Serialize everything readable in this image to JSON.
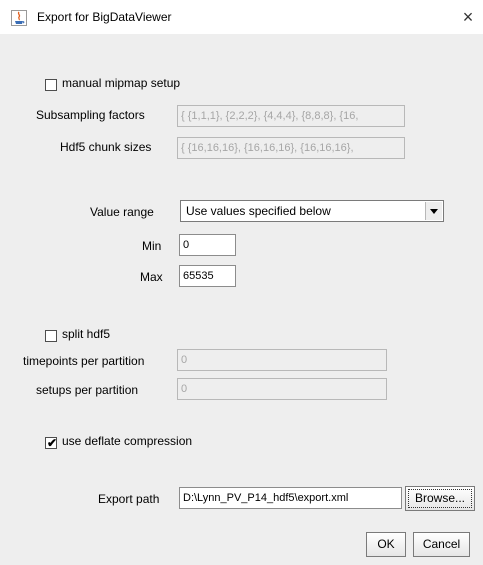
{
  "window": {
    "title": "Export for BigDataViewer",
    "close_symbol": "×"
  },
  "mipmap": {
    "checkbox_label": "manual mipmap setup",
    "checked": false,
    "subsampling_label": "Subsampling factors",
    "subsampling_value": "{ {1,1,1}, {2,2,2}, {4,4,4}, {8,8,8}, {16,",
    "chunk_label": "Hdf5 chunk sizes",
    "chunk_value": "{ {16,16,16}, {16,16,16}, {16,16,16},"
  },
  "range": {
    "label": "Value range",
    "selected": "Use values specified below",
    "min_label": "Min",
    "min_value": "0",
    "max_label": "Max",
    "max_value": "65535"
  },
  "split": {
    "checkbox_label": "split hdf5",
    "checked": false,
    "timepoints_label": "timepoints per partition",
    "timepoints_value": "0",
    "setups_label": "setups per partition",
    "setups_value": "0"
  },
  "compression": {
    "checkbox_label": "use deflate compression",
    "checked": true,
    "check_mark": "✔"
  },
  "export": {
    "label": "Export path",
    "path": "D:\\Lynn_PV_P14_hdf5\\export.xml",
    "browse_label": "Browse..."
  },
  "buttons": {
    "ok": "OK",
    "cancel": "Cancel"
  },
  "colors": {
    "panel_bg": "#eeeeee",
    "disabled_text": "#a6a6a6"
  }
}
